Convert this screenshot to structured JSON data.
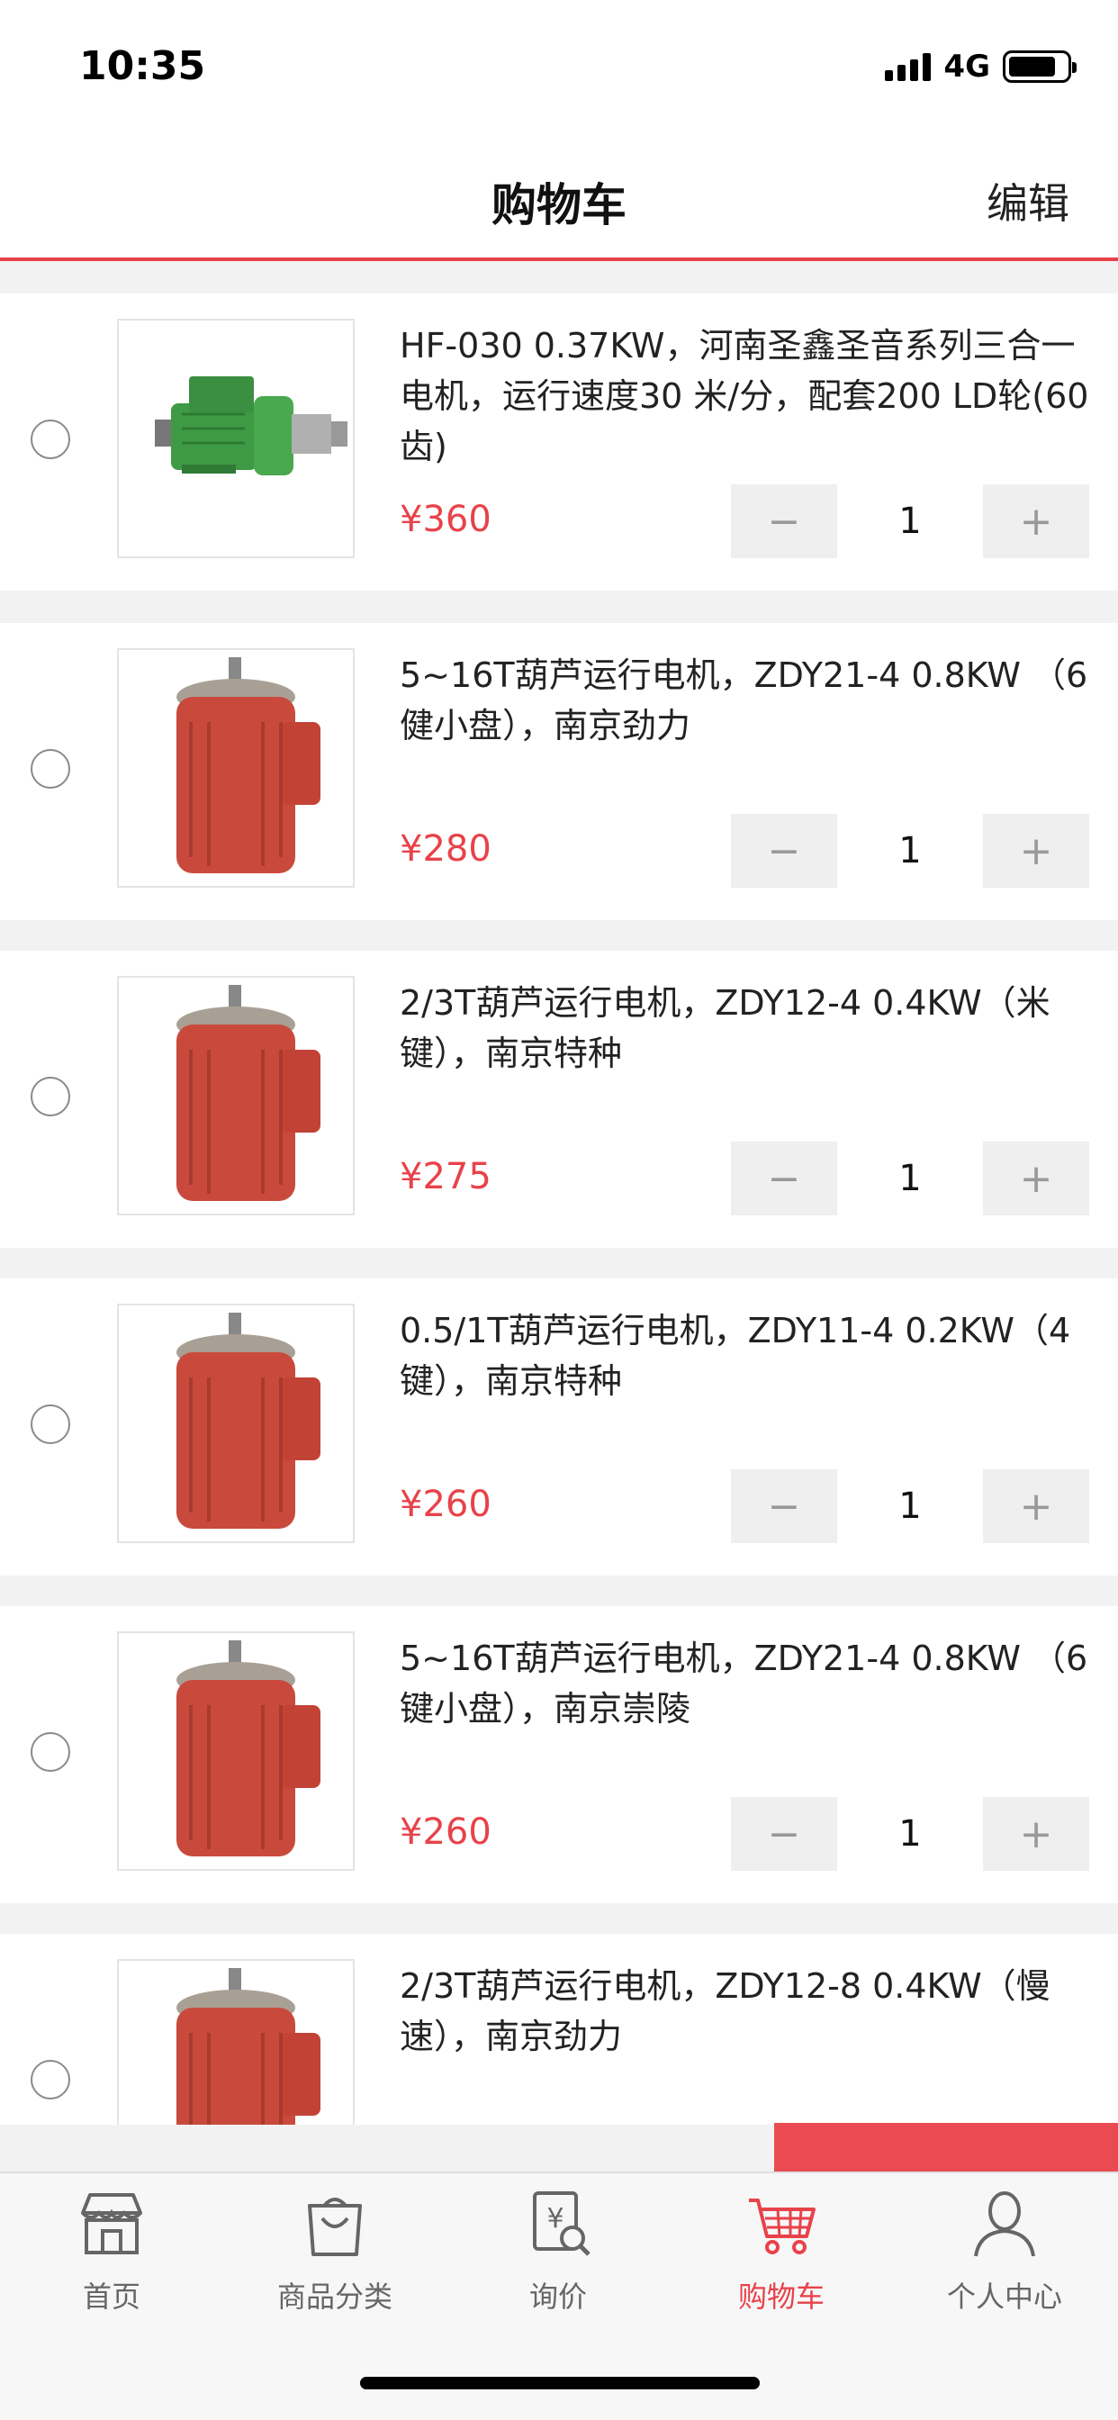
{
  "status": {
    "time": "10:35",
    "network": "4G"
  },
  "nav": {
    "title": "购物车",
    "edit_label": "编辑"
  },
  "colors": {
    "accent": "#e8424a",
    "motor_red": "#c94a3c",
    "motor_green": "#3f9a45"
  },
  "items": [
    {
      "title": "HF-030  0.37KW，河南圣鑫圣音系列三合一电机，运行速度30 米/分，配套200 LD轮(60齿)",
      "price": "¥360",
      "qty": "1",
      "image": "green-motor"
    },
    {
      "title": "5~16T葫芦运行电机，ZDY21-4  0.8KW （6健小盘），南京劲力",
      "price": "¥280",
      "qty": "1",
      "image": "red-motor"
    },
    {
      "title": "2/3T葫芦运行电机，ZDY12-4  0.4KW（米键），南京特种",
      "price": "¥275",
      "qty": "1",
      "image": "red-motor"
    },
    {
      "title": "0.5/1T葫芦运行电机，ZDY11-4  0.2KW（4键），南京特种",
      "price": "¥260",
      "qty": "1",
      "image": "red-motor"
    },
    {
      "title": "5~16T葫芦运行电机，ZDY21-4  0.8KW （6键小盘），南京崇陵",
      "price": "¥260",
      "qty": "1",
      "image": "red-motor"
    },
    {
      "title": "2/3T葫芦运行电机，ZDY12-8  0.4KW（慢速），南京劲力",
      "price": "",
      "qty": "",
      "image": "red-motor"
    }
  ],
  "stepper": {
    "minus": "−",
    "plus": "+"
  },
  "tabs": [
    {
      "label": "首页",
      "icon": "storefront-icon",
      "active": false
    },
    {
      "label": "商品分类",
      "icon": "shopping-bag-icon",
      "active": false
    },
    {
      "label": "询价",
      "icon": "price-inquiry-icon",
      "active": false
    },
    {
      "label": "购物车",
      "icon": "cart-icon",
      "active": true
    },
    {
      "label": "个人中心",
      "icon": "person-icon",
      "active": false
    }
  ]
}
